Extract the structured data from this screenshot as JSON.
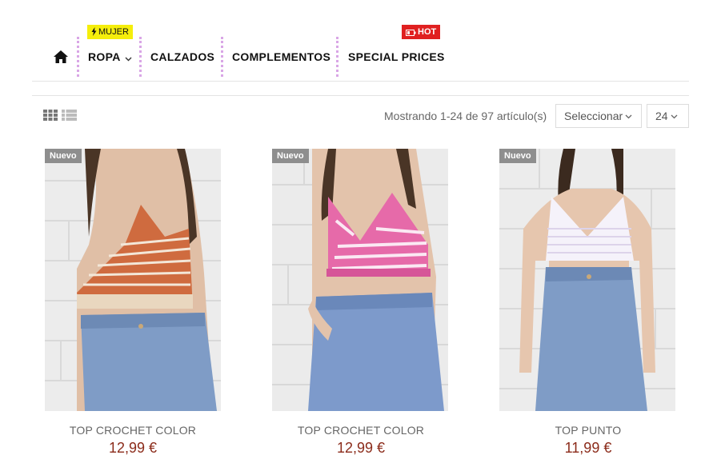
{
  "nav": {
    "home_icon": "home-icon",
    "items": [
      {
        "label": "ROPA",
        "badge": "MUJER",
        "badge_icon": "bolt-icon",
        "has_dropdown": true
      },
      {
        "label": "CALZADOS"
      },
      {
        "label": "COMPLEMENTOS"
      },
      {
        "label": "SPECIAL PRICES",
        "badge": "HOT",
        "badge_icon": "battery-icon"
      }
    ],
    "colors": {
      "mujer_badge": "#f5ee0b",
      "hot_badge": "#e02020",
      "separator": "#d9a6e6"
    }
  },
  "toolbar": {
    "view_icons": [
      "grid-view-icon",
      "list-view-icon"
    ],
    "count_text": "Mostrando 1-24 de 97 artículo(s)",
    "sort_label": "Seleccionar",
    "per_page": "24"
  },
  "products": [
    {
      "badge": "Nuevo",
      "name": "TOP CROCHET COLOR",
      "price": "12,99 €"
    },
    {
      "badge": "Nuevo",
      "name": "TOP CROCHET COLOR",
      "price": "12,99 €"
    },
    {
      "badge": "Nuevo",
      "name": "TOP PUNTO",
      "price": "11,99 €"
    }
  ],
  "colors": {
    "price": "#8b2b1a",
    "new_badge": "#8e8e8e"
  }
}
